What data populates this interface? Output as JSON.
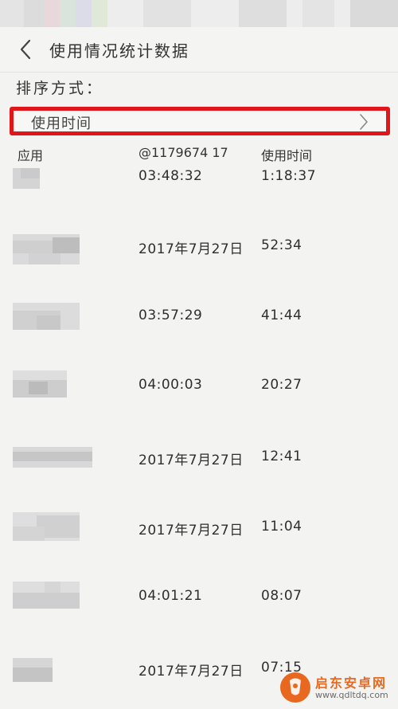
{
  "header": {
    "title": "使用情况统计数据",
    "back_icon": "chevron-left-icon"
  },
  "sort": {
    "label": "排序方式：",
    "value": "使用时间",
    "arrow_icon": "chevron-right-icon",
    "highlight_color": "#e0161b"
  },
  "table": {
    "columns": [
      "应用",
      "@1179674 17",
      "使用时间"
    ],
    "rows": [
      {
        "last_used": "03:48:32",
        "usage_time": "1:18:37"
      },
      {
        "last_used": "2017年7月27日",
        "usage_time": "52:34"
      },
      {
        "last_used": "03:57:29",
        "usage_time": "41:44"
      },
      {
        "last_used": "04:00:03",
        "usage_time": "20:27"
      },
      {
        "last_used": "2017年7月27日",
        "usage_time": "12:41"
      },
      {
        "last_used": "2017年7月27日",
        "usage_time": "11:04"
      },
      {
        "last_used": "04:01:21",
        "usage_time": "08:07"
      },
      {
        "last_used": "2017年7月27日",
        "usage_time": "07:15"
      }
    ]
  },
  "watermark": {
    "name": "启东安卓网",
    "url": "www.qdltdq.com",
    "color": "#e8681f"
  }
}
